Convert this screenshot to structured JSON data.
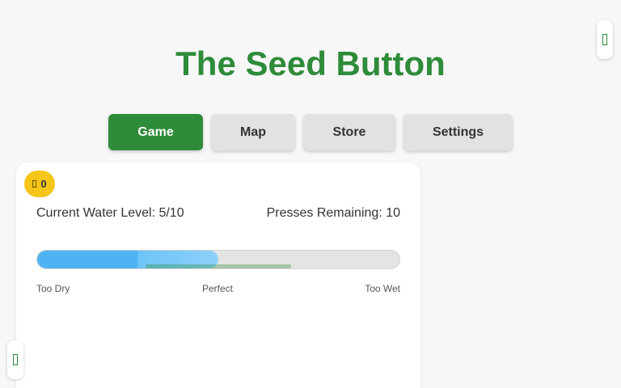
{
  "title": "The Seed Button",
  "nav": {
    "tabs": [
      {
        "label": "Game",
        "active": true
      },
      {
        "label": "Map",
        "active": false
      },
      {
        "label": "Store",
        "active": false
      },
      {
        "label": "Settings",
        "active": false
      }
    ]
  },
  "coins": {
    "icon": "coin-icon",
    "count": "0"
  },
  "status": {
    "water_level": "Current Water Level: 5/10",
    "presses_remaining": "Presses Remaining: 10"
  },
  "meter": {
    "level_fraction": 0.5,
    "scale_labels": {
      "dry": "Too Dry",
      "perfect": "Perfect",
      "wet": "Too Wet"
    }
  },
  "side_tabs": {
    "top_right_icon": "panel-toggle-icon",
    "bottom_left_icon": "panel-toggle-icon"
  },
  "colors": {
    "accent": "#2e8b3a",
    "water": "#4fb3f3",
    "coin": "#f5c518",
    "background": "#f7f7f7"
  }
}
